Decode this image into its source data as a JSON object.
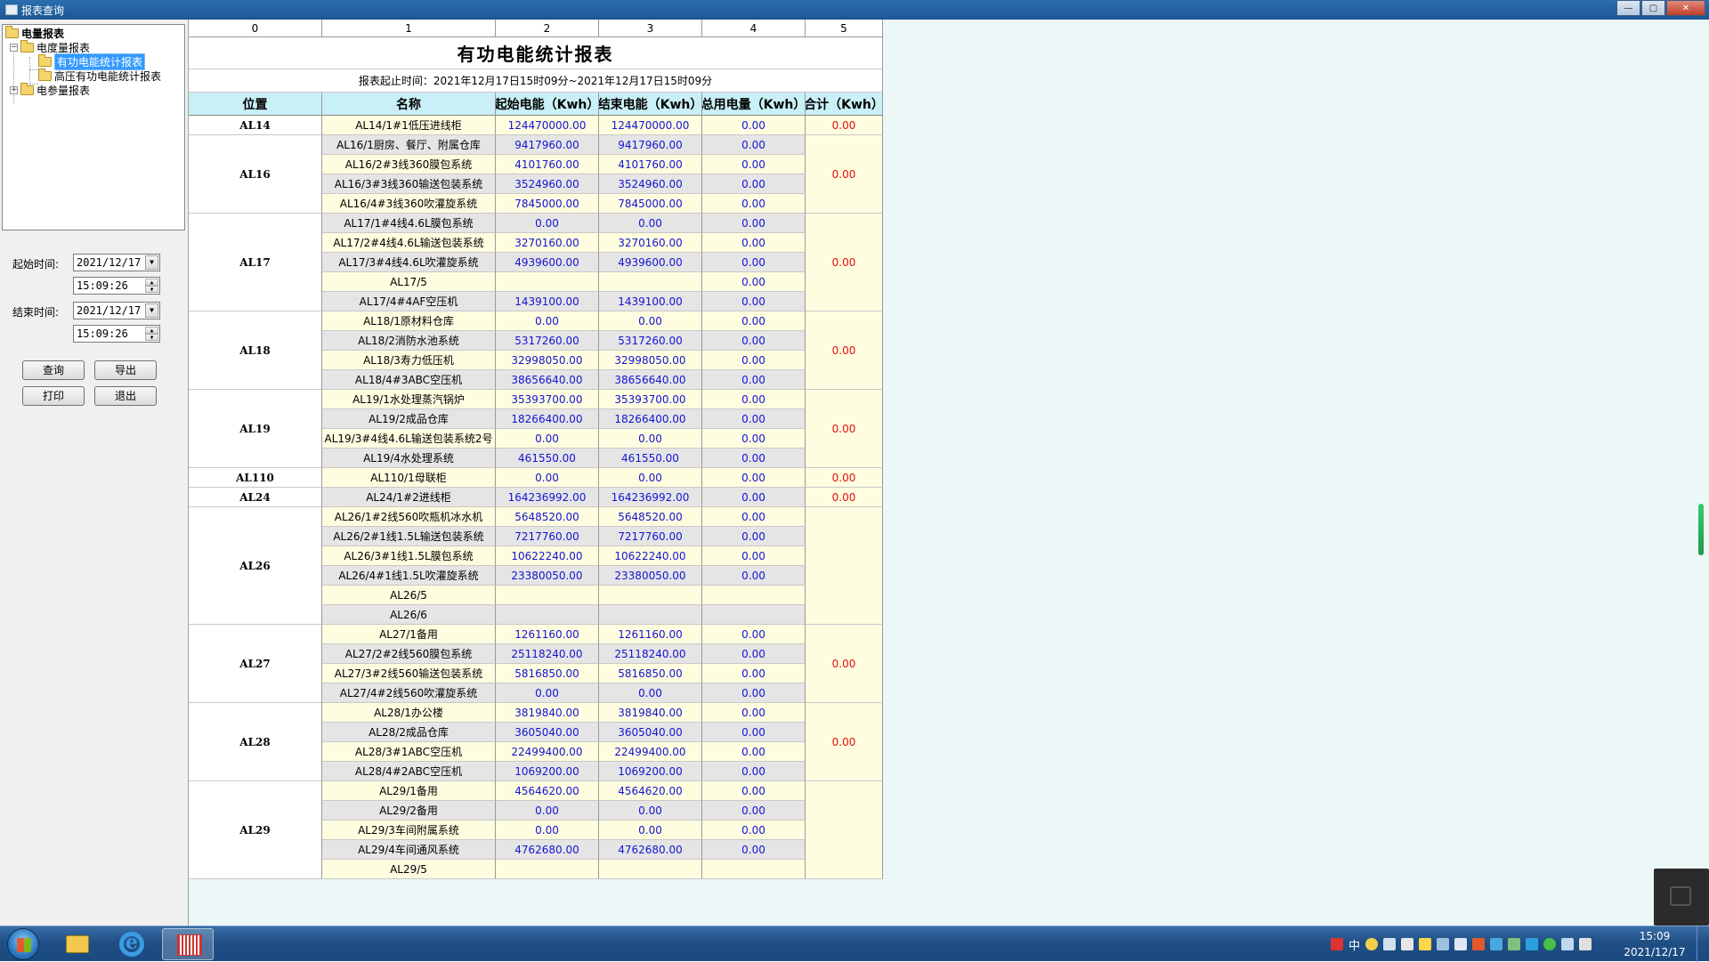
{
  "window": {
    "title": "报表查询",
    "subtitle": "",
    "min_glyph": "—",
    "max_glyph": "▢",
    "close_glyph": "✕"
  },
  "tree": {
    "root": "电量报表",
    "node1": "电度量报表",
    "node1_children": [
      "有功电能统计报表",
      "高压有功电能统计报表"
    ],
    "node2": "电参量报表",
    "expanded_glyph": "−",
    "collapsed_glyph": "+"
  },
  "filters": {
    "start_label": "起始时间:",
    "start_date": "2021/12/17",
    "start_time": "15:09:26",
    "end_label": "结束时间:",
    "end_date": "2021/12/17",
    "end_time": "15:09:26"
  },
  "buttons": {
    "query": "查询",
    "export": "导出",
    "print": "打印",
    "exit": "退出"
  },
  "grid": {
    "col_indices": [
      "0",
      "1",
      "2",
      "3",
      "4",
      "5"
    ],
    "report_title": "有功电能统计报表",
    "report_period": "报表起止时间：2021年12月17日15时09分~2021年12月17日15时09分",
    "headers": [
      "位置",
      "名称",
      "起始电能（Kwh）",
      "结束电能（Kwh）",
      "总用电量（Kwh）",
      "合计（Kwh）"
    ],
    "groups": [
      {
        "pos": "AL14",
        "total": "0.00",
        "rows": [
          [
            "AL14/1#1低压进线柜",
            "124470000.00",
            "124470000.00",
            "0.00"
          ]
        ]
      },
      {
        "pos": "AL16",
        "total": "0.00",
        "rows": [
          [
            "AL16/1厨房、餐厅、附属仓库",
            "9417960.00",
            "9417960.00",
            "0.00"
          ],
          [
            "AL16/2#3线360膜包系统",
            "4101760.00",
            "4101760.00",
            "0.00"
          ],
          [
            "AL16/3#3线360输送包装系统",
            "3524960.00",
            "3524960.00",
            "0.00"
          ],
          [
            "AL16/4#3线360吹灌旋系统",
            "7845000.00",
            "7845000.00",
            "0.00"
          ]
        ]
      },
      {
        "pos": "AL17",
        "total": "0.00",
        "rows": [
          [
            "AL17/1#4线4.6L膜包系统",
            "0.00",
            "0.00",
            "0.00"
          ],
          [
            "AL17/2#4线4.6L输送包装系统",
            "3270160.00",
            "3270160.00",
            "0.00"
          ],
          [
            "AL17/3#4线4.6L吹灌旋系统",
            "4939600.00",
            "4939600.00",
            "0.00"
          ],
          [
            "AL17/5",
            "",
            "",
            "0.00"
          ],
          [
            "AL17/4#4AF空压机",
            "1439100.00",
            "1439100.00",
            "0.00"
          ]
        ]
      },
      {
        "pos": "AL18",
        "total": "0.00",
        "rows": [
          [
            "AL18/1原材料仓库",
            "0.00",
            "0.00",
            "0.00"
          ],
          [
            "AL18/2消防水池系统",
            "5317260.00",
            "5317260.00",
            "0.00"
          ],
          [
            "AL18/3寿力低压机",
            "32998050.00",
            "32998050.00",
            "0.00"
          ],
          [
            "AL18/4#3ABC空压机",
            "38656640.00",
            "38656640.00",
            "0.00"
          ]
        ]
      },
      {
        "pos": "AL19",
        "total": "0.00",
        "rows": [
          [
            "AL19/1水处理蒸汽锅炉",
            "35393700.00",
            "35393700.00",
            "0.00"
          ],
          [
            "AL19/2成品仓库",
            "18266400.00",
            "18266400.00",
            "0.00"
          ],
          [
            "AL19/3#4线4.6L输送包装系统2号",
            "0.00",
            "0.00",
            "0.00"
          ],
          [
            "AL19/4水处理系统",
            "461550.00",
            "461550.00",
            "0.00"
          ]
        ]
      },
      {
        "pos": "AL110",
        "total": "0.00",
        "rows": [
          [
            "AL110/1母联柜",
            "0.00",
            "0.00",
            "0.00"
          ]
        ]
      },
      {
        "pos": "AL24",
        "total": "0.00",
        "rows": [
          [
            "AL24/1#2进线柜",
            "164236992.00",
            "164236992.00",
            "0.00"
          ]
        ]
      },
      {
        "pos": "AL26",
        "total": "",
        "rows": [
          [
            "AL26/1#2线560吹瓶机冰水机",
            "5648520.00",
            "5648520.00",
            "0.00"
          ],
          [
            "AL26/2#1线1.5L输送包装系统",
            "7217760.00",
            "7217760.00",
            "0.00"
          ],
          [
            "AL26/3#1线1.5L膜包系统",
            "10622240.00",
            "10622240.00",
            "0.00"
          ],
          [
            "AL26/4#1线1.5L吹灌旋系统",
            "23380050.00",
            "23380050.00",
            "0.00"
          ],
          [
            "AL26/5",
            "",
            "",
            ""
          ],
          [
            "AL26/6",
            "",
            "",
            ""
          ]
        ]
      },
      {
        "pos": "AL27",
        "total": "0.00",
        "rows": [
          [
            "AL27/1备用",
            "1261160.00",
            "1261160.00",
            "0.00"
          ],
          [
            "AL27/2#2线560膜包系统",
            "25118240.00",
            "25118240.00",
            "0.00"
          ],
          [
            "AL27/3#2线560输送包装系统",
            "5816850.00",
            "5816850.00",
            "0.00"
          ],
          [
            "AL27/4#2线560吹灌旋系统",
            "0.00",
            "0.00",
            "0.00"
          ]
        ]
      },
      {
        "pos": "AL28",
        "total": "0.00",
        "rows": [
          [
            "AL28/1办公楼",
            "3819840.00",
            "3819840.00",
            "0.00"
          ],
          [
            "AL28/2成品仓库",
            "3605040.00",
            "3605040.00",
            "0.00"
          ],
          [
            "AL28/3#1ABC空压机",
            "22499400.00",
            "22499400.00",
            "0.00"
          ],
          [
            "AL28/4#2ABC空压机",
            "1069200.00",
            "1069200.00",
            "0.00"
          ]
        ]
      },
      {
        "pos": "AL29",
        "total": "",
        "rows": [
          [
            "AL29/1备用",
            "4564620.00",
            "4564620.00",
            "0.00"
          ],
          [
            "AL29/2备用",
            "0.00",
            "0.00",
            "0.00"
          ],
          [
            "AL29/3车间附属系统",
            "0.00",
            "0.00",
            "0.00"
          ],
          [
            "AL29/4车间通风系统",
            "4762680.00",
            "4762680.00",
            "0.00"
          ],
          [
            "AL29/5",
            "",
            "",
            ""
          ]
        ]
      }
    ]
  },
  "taskbar": {
    "clock_time": "15:09",
    "clock_date": "2021/12/17",
    "ime_label": "中"
  },
  "colors": {
    "number_text": "#1414d2",
    "total_text": "#e01010",
    "header_bg": "#c9f0f6",
    "row_yellow": "#fffde0",
    "row_gray": "#e5e5e5",
    "grid_bg": "#ebf8f7"
  }
}
